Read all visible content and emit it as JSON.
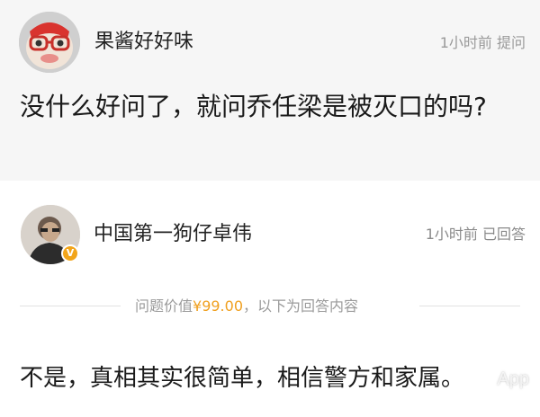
{
  "question": {
    "asker_name": "果酱好好味",
    "asker_time": "1小时前",
    "asker_action": "提问",
    "text": "没什么好问了，就问乔任梁是被灭口的吗?"
  },
  "answer": {
    "answerer_name": "中国第一狗仔卓伟",
    "answer_time": "1小时前",
    "answer_status": "已回答",
    "verified_badge": "V",
    "price_prefix": "问题价值",
    "price_value": "¥99.00",
    "price_suffix": "，以下为回答内容",
    "text": "不是，真相其实很简单，相信警方和家属。"
  },
  "watermark": "App",
  "colors": {
    "question_bg": "#f6f6f6",
    "price_accent": "#f0a020",
    "verified": "#f2a51a",
    "meta_text": "#9a9a9a"
  }
}
